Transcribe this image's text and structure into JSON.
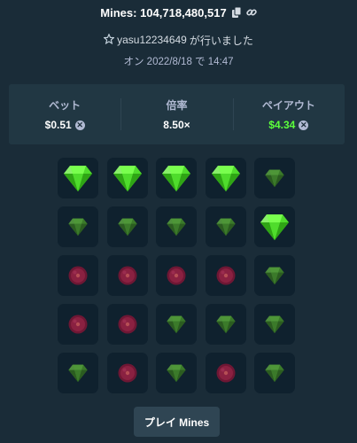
{
  "header": {
    "title": "Mines: 104,718,480,517",
    "copy_icon": "copy-icon",
    "link_icon": "link-icon"
  },
  "player": {
    "star_icon": "star-icon",
    "name": "yasu12234649",
    "suffix": "が行いました"
  },
  "date": "オン 2022/8/18 で 14:47",
  "stats": {
    "bet_label": "ベット",
    "bet_value": "$0.51",
    "multiplier_label": "倍率",
    "multiplier_value": "8.50×",
    "payout_label": "ペイアウト",
    "payout_value": "$4.34",
    "coin_icon": "coin-icon"
  },
  "colors": {
    "background": "#1a2c38",
    "panel": "#213743",
    "tile": "#0f212e",
    "gem_revealed": "#5cff3c",
    "gem_hidden": "#3a7d2a",
    "mine_hidden": "#7a1f3a",
    "payout_text": "#5cff3c"
  },
  "grid": {
    "cells": [
      "gem-revealed",
      "gem-revealed",
      "gem-revealed",
      "gem-revealed",
      "gem-dim",
      "gem-dim",
      "gem-dim",
      "gem-dim",
      "gem-dim",
      "gem-revealed",
      "mine-dim",
      "mine-dim",
      "mine-dim",
      "mine-dim",
      "gem-dim",
      "mine-dim",
      "mine-dim",
      "gem-dim",
      "gem-dim",
      "gem-dim",
      "gem-dim",
      "mine-dim",
      "gem-dim",
      "mine-dim",
      "gem-dim"
    ]
  },
  "play_button": "プレイ Mines"
}
